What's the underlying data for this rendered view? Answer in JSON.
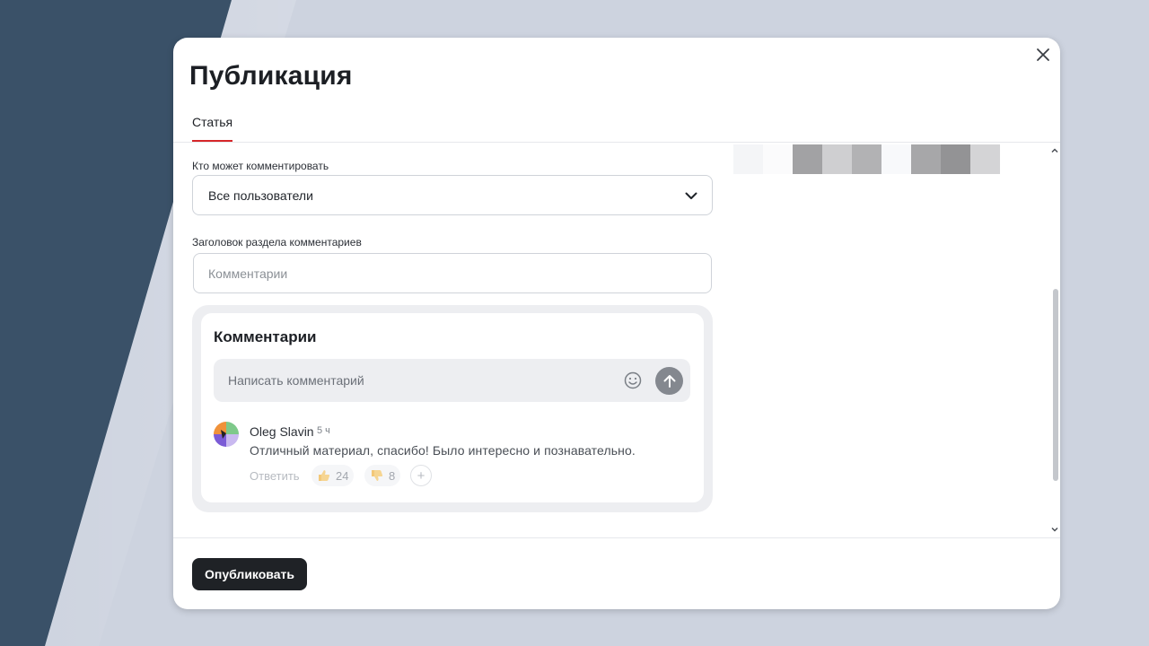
{
  "modal": {
    "title": "Публикация",
    "close_icon": "close-icon"
  },
  "tabs": [
    {
      "label": "Статья",
      "active": true
    }
  ],
  "comments_access": {
    "label": "Кто может комментировать",
    "selected": "Все пользователи",
    "icon": "chevron-down-icon"
  },
  "comments_heading": {
    "label": "Заголовок раздела комментариев",
    "value": "",
    "placeholder": "Комментарии"
  },
  "preview": {
    "title": "Комментарии",
    "comment_placeholder": "Написать комментарий",
    "emoji_icon": "smile-icon",
    "send_icon": "arrow-up-icon",
    "comment": {
      "author": "Oleg Slavin",
      "time": "5 ч",
      "text": "Отличный материал, спасибо! Было интересно и познавательно.",
      "reply_label": "Ответить",
      "likes": "24",
      "dislikes": "8",
      "like_icon": "thumbs-up-icon",
      "dislike_icon": "thumbs-down-icon",
      "add_reaction_icon": "plus-icon"
    }
  },
  "footer": {
    "publish_label": "Опубликовать"
  },
  "colors": {
    "accent": "#d6272a",
    "primary_button": "#1f2226",
    "send_button": "#84888f",
    "backdrop": "#cdd3df",
    "backdrop_dark": "#3a5168"
  }
}
